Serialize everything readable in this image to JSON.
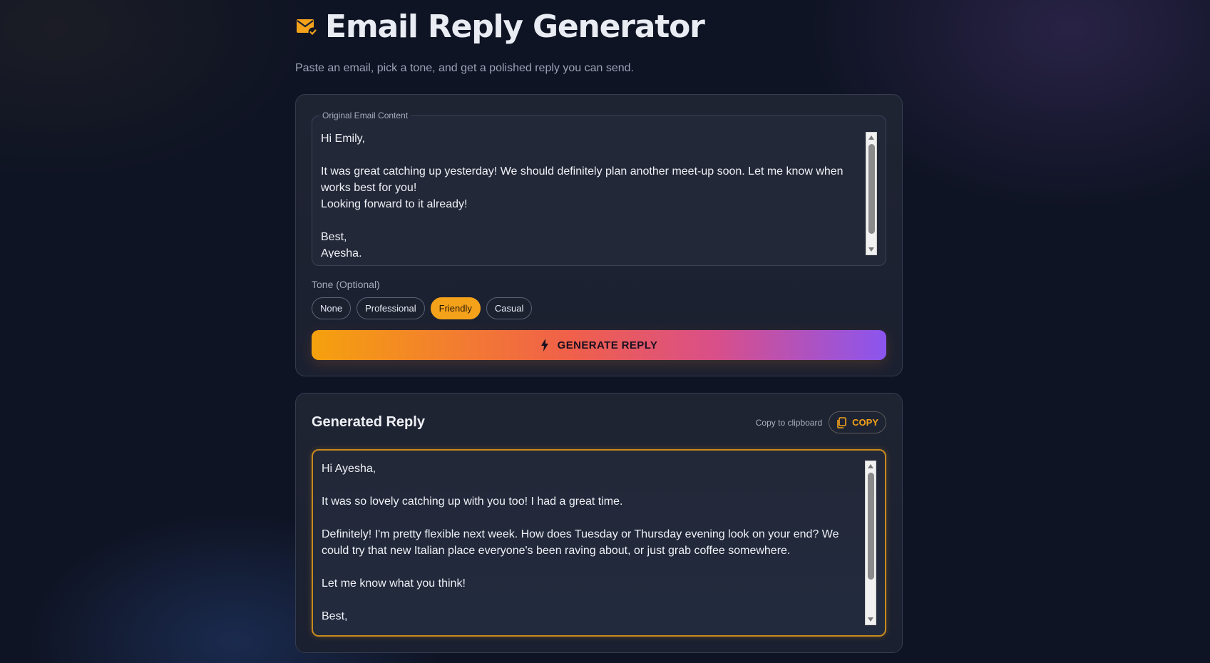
{
  "header": {
    "title": "Email Reply Generator",
    "subtitle": "Paste an email, pick a tone, and get a polished reply you can send."
  },
  "input": {
    "legend": "Original Email Content",
    "value": "Hi Emily,\n\nIt was great catching up yesterday! We should definitely plan another meet-up soon. Let me know when works best for you!\nLooking forward to it already!\n\nBest,\nAyesha."
  },
  "tone": {
    "label": "Tone (Optional)",
    "options": [
      "None",
      "Professional",
      "Friendly",
      "Casual"
    ],
    "selected": "Friendly"
  },
  "generate": {
    "label": "GENERATE REPLY"
  },
  "reply": {
    "title": "Generated Reply",
    "copy_hint": "Copy to clipboard",
    "copy_label": "COPY",
    "value": "Hi Ayesha,\n\nIt was so lovely catching up with you too! I had a great time.\n\nDefinitely! I'm pretty flexible next week. How does Tuesday or Thursday evening look on your end? We could try that new Italian place everyone's been raving about, or just grab coffee somewhere.\n\nLet me know what you think!\n\nBest,"
  },
  "colors": {
    "accent": "#f5a21b",
    "background": "#0f1424",
    "card": "#1f2433"
  },
  "icons": {
    "title": "mail-check-icon",
    "generate": "lightning-icon",
    "copy": "copy-icon"
  }
}
